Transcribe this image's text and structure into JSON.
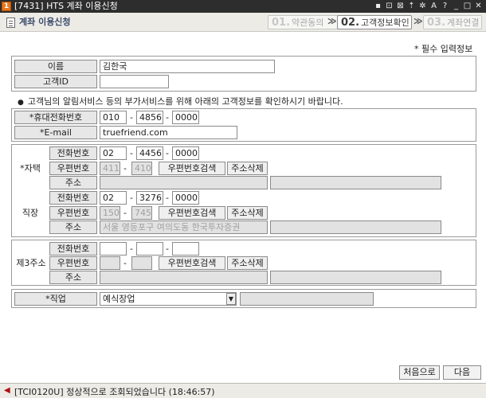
{
  "window": {
    "icon_text": "1",
    "title": "[7431] HTS 계좌 이용신청",
    "title_icons": [
      "pin-icon",
      "link-icon",
      "window-icon",
      "keep-on-top-icon",
      "settings-icon",
      "font-size-icon",
      "help-icon",
      "minimize-icon",
      "maximize-icon",
      "close-icon"
    ],
    "title_icon_glyphs": [
      "▪",
      "⊡",
      "⊠",
      "⇡",
      "✲",
      "A",
      "?",
      "_",
      "□",
      "✕"
    ]
  },
  "header": {
    "title": "계좌 이용신청",
    "steps": [
      {
        "num": "01.",
        "label": "약관동의",
        "active": false
      },
      {
        "num": "02.",
        "label": "고객정보확인",
        "active": true
      },
      {
        "num": "03.",
        "label": "계좌연결",
        "active": false
      }
    ],
    "arrow": "≫"
  },
  "required_note": "* 필수 입력정보",
  "customer": {
    "name_label": "이름",
    "name_value": "김한국",
    "id_label": "고객ID",
    "id_value": ""
  },
  "notice": {
    "bullet": "●",
    "text": "고객님의 알림서비스 등의 부가서비스를 위해 아래의 고객정보를 확인하시기 바랍니다."
  },
  "contact": {
    "mobile_label": "*휴대전화번호",
    "mobile": [
      "010",
      "4856",
      "0000"
    ],
    "email_label": "*E-mail",
    "email": "truefriend.com"
  },
  "sections": {
    "home": {
      "label": "*자택",
      "phone_label": "전화번호",
      "phone": [
        "02",
        "4456",
        "0000"
      ],
      "zip_label": "우편번호",
      "zip": [
        "411",
        "410"
      ],
      "address_label": "주소",
      "address": "",
      "address_detail": ""
    },
    "work": {
      "label": "직장",
      "phone_label": "전화번호",
      "phone": [
        "02",
        "3276",
        "0000"
      ],
      "zip_label": "우편번호",
      "zip": [
        "150",
        "745"
      ],
      "address_label": "주소",
      "address": "서울 영등포구 여의도동 한국투자증권",
      "address_detail": ""
    },
    "third": {
      "label": "제3주소",
      "phone_label": "전화번호",
      "phone": [
        "",
        "",
        ""
      ],
      "zip_label": "우편번호",
      "zip": [
        "",
        ""
      ],
      "address_label": "주소",
      "address": "",
      "address_detail": ""
    }
  },
  "buttons": {
    "zip_search": "우편번호검색",
    "address_delete": "주소삭제",
    "first": "처음으로",
    "next": "다음"
  },
  "job": {
    "label": "*직업",
    "selected": "예식장업",
    "detail": ""
  },
  "dash": "-",
  "status": {
    "code": "[TCI0120U]",
    "message": "정상적으로 조회되었습니다",
    "time": "(18:46:57)"
  }
}
